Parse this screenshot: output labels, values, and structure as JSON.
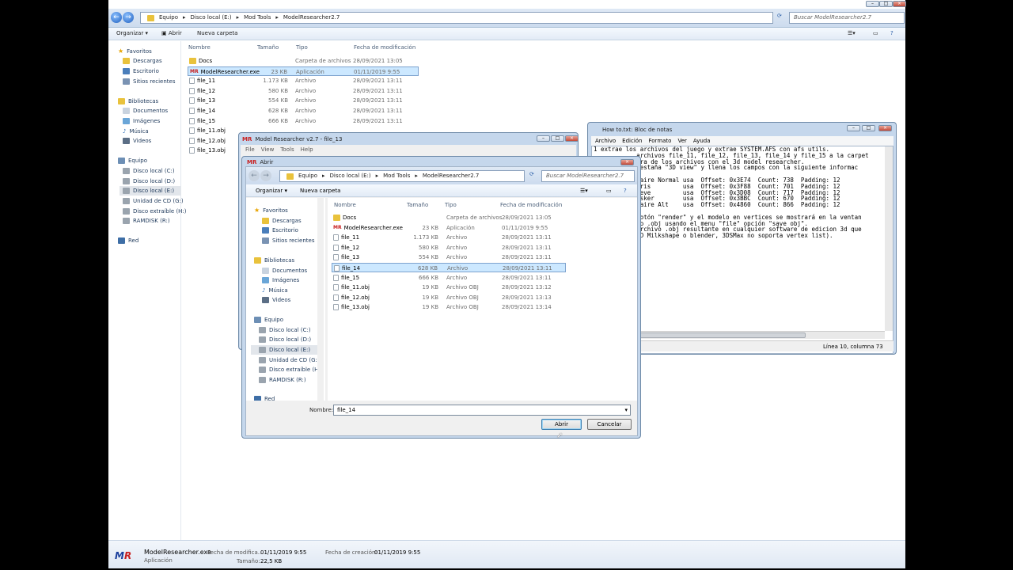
{
  "explorer": {
    "crumbs": [
      "Equipo",
      "Disco local (E:)",
      "Mod Tools",
      "ModelResearcher2.7"
    ],
    "search_placeholder": "Buscar ModelResearcher2.7",
    "toolbar": {
      "organize": "Organizar",
      "open": "Abrir",
      "new_folder": "Nueva carpeta"
    },
    "columns": {
      "name": "Nombre",
      "size": "Tamaño",
      "type": "Tipo",
      "date": "Fecha de modificación"
    },
    "nav": {
      "favorites": "Favoritos",
      "downloads": "Descargas",
      "desktop": "Escritorio",
      "recent": "Sitios recientes",
      "libraries": "Bibliotecas",
      "documents": "Documentos",
      "images": "Imágenes",
      "music": "Música",
      "videos": "Videos",
      "computer": "Equipo",
      "c": "Disco local (C:)",
      "d": "Disco local (D:)",
      "e": "Disco local (E:)",
      "g": "Unidad de CD (G:)",
      "h": "Disco extraíble (H:)",
      "r": "RAMDISK (R:)",
      "network": "Red"
    },
    "files": [
      {
        "name": "Docs",
        "size": "",
        "type": "Carpeta de archivos",
        "date": "28/09/2021 13:05"
      },
      {
        "name": "ModelResearcher.exe",
        "size": "23 KB",
        "type": "Aplicación",
        "date": "01/11/2019 9:55"
      },
      {
        "name": "file_11",
        "size": "1.173 KB",
        "type": "Archivo",
        "date": "28/09/2021 13:11"
      },
      {
        "name": "file_12",
        "size": "580 KB",
        "type": "Archivo",
        "date": "28/09/2021 13:11"
      },
      {
        "name": "file_13",
        "size": "554 KB",
        "type": "Archivo",
        "date": "28/09/2021 13:11"
      },
      {
        "name": "file_14",
        "size": "628 KB",
        "type": "Archivo",
        "date": "28/09/2021 13:11"
      },
      {
        "name": "file_15",
        "size": "666 KB",
        "type": "Archivo",
        "date": "28/09/2021 13:11"
      },
      {
        "name": "file_11.obj",
        "size": "",
        "type": "",
        "date": ""
      },
      {
        "name": "file_12.obj",
        "size": "",
        "type": "",
        "date": ""
      },
      {
        "name": "file_13.obj",
        "size": "",
        "type": "",
        "date": ""
      }
    ],
    "status": {
      "name": "ModelResearcher.exe",
      "kind": "Aplicación",
      "mod_label": "Fecha de modifica...",
      "mod": "01/11/2019 9:55",
      "size_label": "Tamaño:",
      "size": "22,5 KB",
      "created_label": "Fecha de creación:",
      "created": "01/11/2019 9:55"
    }
  },
  "mr_window": {
    "title": "Model Researcher v2.7 - file_13",
    "menu": [
      "File",
      "View",
      "Tools",
      "Help"
    ]
  },
  "notepad": {
    "title": "How to.txt: Bloc de notas",
    "menu": [
      "Archivo",
      "Edición",
      "Formato",
      "Ver",
      "Ayuda"
    ],
    "status": "Línea 10, columna 73",
    "text": "1 extrae los archivos del juego y extrae SYSTEM.AFS con afs utils.\n            archivos file_11, file_12, file_13, file_14 y file_15 a la carpet\n            era de los archivos con el 3d model researcher.\n            pestaña \"3D view\" y llena los campos con la siguiente informac\n\n           Claire Normal usa  Offset: 0x3E74  Count: 738  Padding: 12\n           Chris         usa  Offset: 0x3F88  Count: 701  Padding: 12\n           Steve         usa  Offset: 0x3D08  Count: 717  Padding: 12\n           Wesker        usa  Offset: 0x3BBC  Count: 670  Padding: 12\n           Claire Alt    usa  Offset: 0x4860  Count: 866  Padding: 12\n\n            botón \"render\" y el modelo en vertices se mostrará en la ventan\n            mo .obj usando el menu \"file\" opción \"save obj\".\n            archivo .obj resultante en cualquier software de edicion 3d que\n            3D Milkshape o blender, 3DSMax no soporta vertex list)."
  },
  "dialog": {
    "title": "Abrir",
    "crumbs": [
      "Equipo",
      "Disco local (E:)",
      "Mod Tools",
      "ModelResearcher2.7"
    ],
    "search_placeholder": "Buscar ModelResearcher2.7",
    "organize": "Organizar",
    "new_folder": "Nueva carpeta",
    "columns": {
      "name": "Nombre",
      "size": "Tamaño",
      "type": "Tipo",
      "date": "Fecha de modificación"
    },
    "files": [
      {
        "name": "Docs",
        "size": "",
        "type": "Carpeta de archivos",
        "date": "28/09/2021 13:05"
      },
      {
        "name": "ModelResearcher.exe",
        "size": "23 KB",
        "type": "Aplicación",
        "date": "01/11/2019 9:55"
      },
      {
        "name": "file_11",
        "size": "1.173 KB",
        "type": "Archivo",
        "date": "28/09/2021 13:11"
      },
      {
        "name": "file_12",
        "size": "580 KB",
        "type": "Archivo",
        "date": "28/09/2021 13:11"
      },
      {
        "name": "file_13",
        "size": "554 KB",
        "type": "Archivo",
        "date": "28/09/2021 13:11"
      },
      {
        "name": "file_14",
        "size": "628 KB",
        "type": "Archivo",
        "date": "28/09/2021 13:11"
      },
      {
        "name": "file_15",
        "size": "666 KB",
        "type": "Archivo",
        "date": "28/09/2021 13:11"
      },
      {
        "name": "file_11.obj",
        "size": "19 KB",
        "type": "Archivo OBJ",
        "date": "28/09/2021 13:12"
      },
      {
        "name": "file_12.obj",
        "size": "19 KB",
        "type": "Archivo OBJ",
        "date": "28/09/2021 13:13"
      },
      {
        "name": "file_13.obj",
        "size": "19 KB",
        "type": "Archivo OBJ",
        "date": "28/09/2021 13:14"
      }
    ],
    "filename_label": "Nombre:",
    "filename": "file_14",
    "open": "Abrir",
    "cancel": "Cancelar"
  }
}
